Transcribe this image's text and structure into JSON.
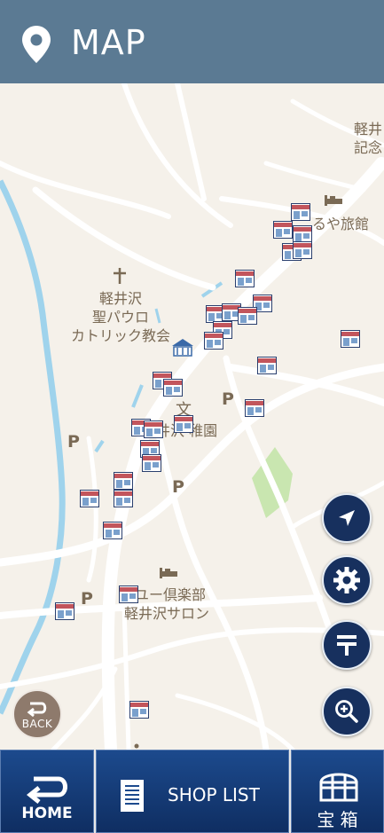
{
  "header": {
    "title": "MAP",
    "icon": "map-pin-icon"
  },
  "map": {
    "labels": {
      "church": [
        "軽井沢",
        "聖パウロ",
        "カトリック教会"
      ],
      "inn": "るや旅館",
      "kinder": "井沢 稚園",
      "club1": "ユー倶楽部",
      "club2": "軽井沢サロン",
      "topright": [
        "軽井",
        "記念"
      ]
    },
    "parking": "P"
  },
  "controls": {
    "locate": "navigation-arrow-icon",
    "settings": "gear-icon",
    "post": "post-office-icon",
    "zoom": "zoom-in-icon",
    "back_label": "BACK"
  },
  "footer": {
    "home_label": "HOME",
    "shoplist_label": "SHOP LIST",
    "treasure_label": "宝 箱"
  },
  "colors": {
    "header": "#5b7a93",
    "fab": "#17305e",
    "footer": "#12346d",
    "water": "#9fd3ec",
    "park": "#c9e6b0"
  }
}
